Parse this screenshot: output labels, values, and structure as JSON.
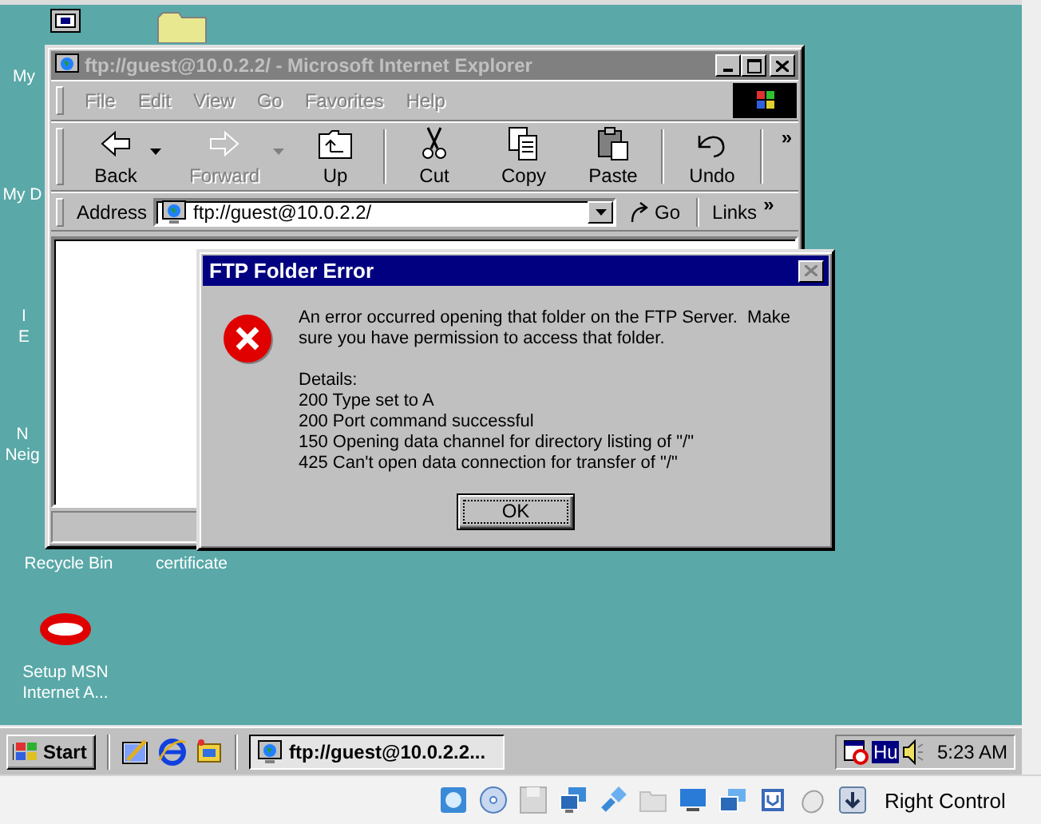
{
  "desktop": {
    "icons": [
      {
        "kind": "computer",
        "lines": [
          "My"
        ]
      },
      {
        "kind": "documents",
        "lines": [
          "My D"
        ]
      },
      {
        "kind": "browser",
        "lines": [
          "I",
          "E"
        ]
      },
      {
        "kind": "network",
        "lines": [
          "N",
          "Neig"
        ]
      },
      {
        "kind": "recycle",
        "lines": [
          "Recycle Bin"
        ]
      },
      {
        "kind": "certificate",
        "lines": [
          "certificate"
        ]
      },
      {
        "kind": "msn",
        "lines": [
          "Setup MSN",
          "Internet A..."
        ]
      }
    ]
  },
  "browser_window": {
    "title": "ftp://guest@10.0.2.2/ - Microsoft Internet Explorer",
    "active": false,
    "menu": [
      {
        "label": "File",
        "disabled": true
      },
      {
        "label": "Edit",
        "disabled": true
      },
      {
        "label": "View",
        "disabled": true
      },
      {
        "label": "Go",
        "disabled": true
      },
      {
        "label": "Favorites",
        "disabled": true
      },
      {
        "label": "Help",
        "disabled": true
      }
    ],
    "toolbar": [
      {
        "kind": "back",
        "label": "Back",
        "disabled": false,
        "dropdown": true
      },
      {
        "kind": "forward",
        "label": "Forward",
        "disabled": true,
        "dropdown": true
      },
      {
        "kind": "up",
        "label": "Up",
        "disabled": false,
        "dropdown": false
      },
      {
        "kind": "cut",
        "label": "Cut",
        "disabled": false,
        "dropdown": false
      },
      {
        "kind": "copy",
        "label": "Copy",
        "disabled": false,
        "dropdown": false
      },
      {
        "kind": "paste",
        "label": "Paste",
        "disabled": false,
        "dropdown": false
      },
      {
        "kind": "undo",
        "label": "Undo",
        "disabled": false,
        "dropdown": false
      }
    ],
    "toolbar_more": "»",
    "address": {
      "label": "Address",
      "value": "ftp://guest@10.0.2.2/",
      "go": "Go",
      "links": "Links",
      "links_more": "»"
    }
  },
  "dialog": {
    "title": "FTP Folder Error",
    "message": "An error occurred opening that folder on the FTP Server.  Make sure you have permission to access that folder.",
    "details_label": "Details:",
    "details": [
      "200 Type set to A",
      "200 Port command successful",
      "150 Opening data channel for directory listing of \"/\"",
      "425 Can't open data connection for transfer of \"/\""
    ],
    "ok": "OK"
  },
  "taskbar": {
    "start": "Start",
    "tasks": [
      {
        "label": "ftp://guest@10.0.2.2...",
        "selected": true
      }
    ],
    "language": "Hu",
    "clock": "5:23 AM"
  },
  "vm_status": {
    "host_key": "Right Control"
  }
}
